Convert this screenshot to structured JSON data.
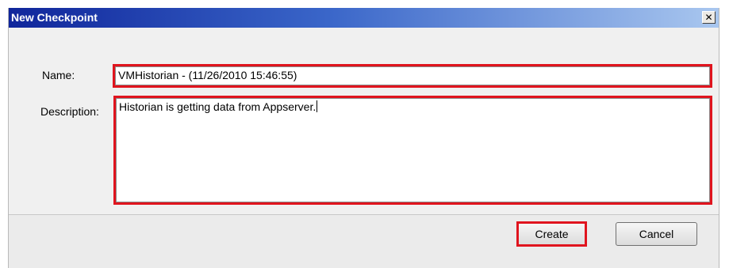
{
  "window": {
    "title": "New Checkpoint",
    "close_glyph": "✕"
  },
  "form": {
    "name_label": "Name:",
    "name_value": "VMHistorian - (11/26/2010 15:46:55)",
    "description_label": "Description:",
    "description_value": "Historian is getting data from Appserver."
  },
  "buttons": {
    "create_label": "Create",
    "cancel_label": "Cancel"
  },
  "colors": {
    "highlight": "#e0141e",
    "titlebar_start": "#10269b",
    "titlebar_end": "#a9c7ef",
    "dialog_bg": "#f0f0f0"
  },
  "icons": {
    "close": "close-icon"
  }
}
